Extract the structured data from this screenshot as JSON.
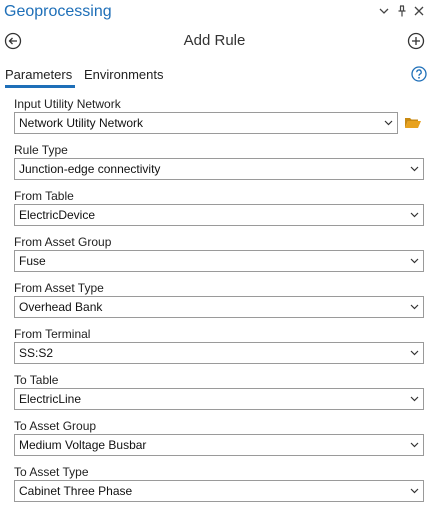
{
  "pane": {
    "title": "Geoprocessing",
    "controls": [
      "chevron-down-icon",
      "pin-icon",
      "close-icon"
    ]
  },
  "tool": {
    "title": "Add Rule",
    "back_icon": "back-arrow-icon",
    "add_icon": "add-circle-icon"
  },
  "tabs": [
    {
      "label": "Parameters",
      "active": true
    },
    {
      "label": "Environments",
      "active": false
    }
  ],
  "help_icon": "help-icon",
  "params": {
    "input_network": {
      "label": "Input Utility Network",
      "value": "Network Utility Network"
    },
    "rule_type": {
      "label": "Rule Type",
      "value": "Junction-edge connectivity"
    },
    "from_table": {
      "label": "From Table",
      "value": "ElectricDevice"
    },
    "from_asset_group": {
      "label": "From Asset Group",
      "value": "Fuse"
    },
    "from_asset_type": {
      "label": "From Asset Type",
      "value": "Overhead Bank"
    },
    "from_terminal": {
      "label": "From Terminal",
      "value": "SS:S2"
    },
    "to_table": {
      "label": "To Table",
      "value": "ElectricLine"
    },
    "to_asset_group": {
      "label": "To Asset Group",
      "value": "Medium Voltage Busbar"
    },
    "to_asset_type": {
      "label": "To Asset Type",
      "value": "Cabinet Three Phase"
    }
  },
  "colors": {
    "accent": "#1e6fb8",
    "folder": "#e8a21e"
  }
}
